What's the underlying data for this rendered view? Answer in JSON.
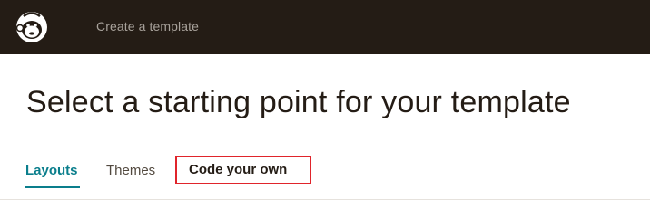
{
  "header": {
    "logo_icon": "mailchimp-freddie-logo-icon",
    "title": "Create a template"
  },
  "main": {
    "heading": "Select a starting point for your template"
  },
  "tabs": [
    {
      "label": "Layouts",
      "active": true
    },
    {
      "label": "Themes",
      "active": false
    },
    {
      "label": "Code your own",
      "active": false,
      "highlighted": true
    }
  ],
  "colors": {
    "topbar_bg": "#241c15",
    "active_tab": "#0a7e8c",
    "highlight_border": "#e0242b"
  }
}
